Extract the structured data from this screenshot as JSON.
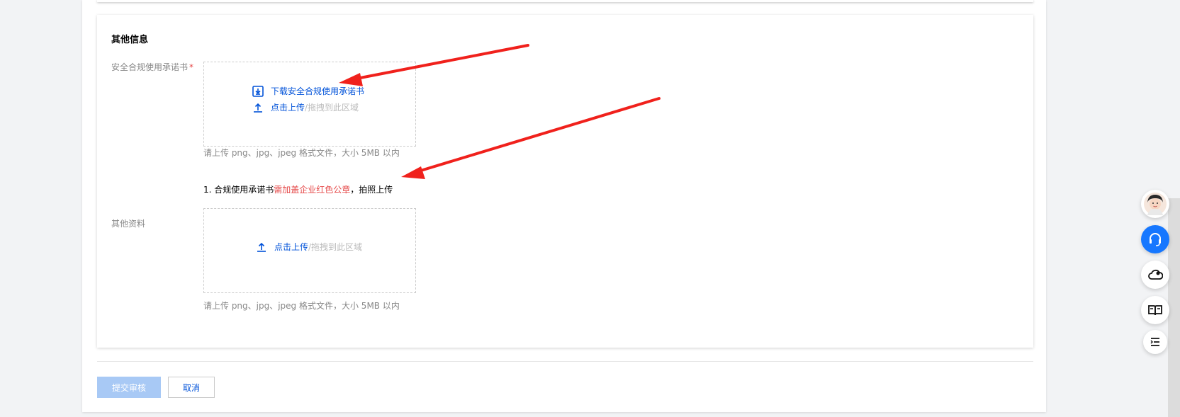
{
  "section": {
    "title": "其他信息"
  },
  "commitment": {
    "label": "安全合规使用承诺书",
    "required_mark": "*",
    "download_link": "下载安全合规使用承诺书",
    "upload_link": "点击上传",
    "drag_text": "/拖拽到此区域",
    "hint": "请上传 png、jpg、jpeg 格式文件，大小 5MB 以内",
    "note_prefix": "1. 合规使用承诺书",
    "note_highlight": "需加盖企业红色公章",
    "note_suffix": "，拍照上传"
  },
  "other": {
    "label": "其他资料",
    "upload_link": "点击上传",
    "drag_text": "/拖拽到此区域",
    "hint": "请上传 png、jpg、jpeg 格式文件，大小 5MB 以内"
  },
  "actions": {
    "submit_label": "提交审核",
    "cancel_label": "取消"
  },
  "float_bar": {
    "icons": [
      "agent-avatar-icon",
      "headset-icon",
      "cloud-user-icon",
      "book-icon",
      "list-icon"
    ]
  },
  "colors": {
    "link": "#0052d9",
    "required": "#e54545",
    "submit_disabled": "#a8c9f5",
    "float_active": "#1677ff",
    "annotation_arrow": "#f0211c"
  }
}
